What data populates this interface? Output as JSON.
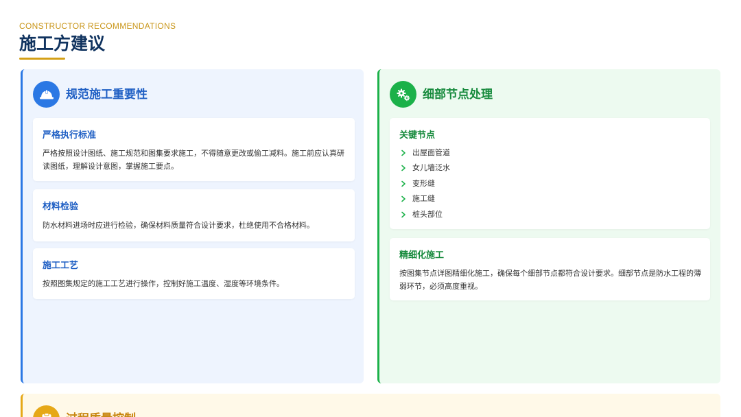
{
  "header": {
    "kicker": "CONSTRUCTOR RECOMMENDATIONS",
    "title": "施工方建议"
  },
  "colors": {
    "blue": "#2b78e4",
    "green": "#1bb149",
    "yellow": "#e6a817",
    "title": "#10335f",
    "gold": "#d4a017"
  },
  "sections": {
    "standards": {
      "icon": "hard-hat-icon",
      "title": "规范施工重要性",
      "items": [
        {
          "heading": "严格执行标准",
          "text": "严格按照设计图纸、施工规范和图集要求施工，不得随意更改或偷工减料。施工前应认真研读图纸，理解设计意图，掌握施工要点。"
        },
        {
          "heading": "材料检验",
          "text": "防水材料进场时应进行检验，确保材料质量符合设计要求，杜绝使用不合格材料。"
        },
        {
          "heading": "施工工艺",
          "text": "按照图集规定的施工工艺进行操作，控制好施工温度、湿度等环境条件。"
        }
      ]
    },
    "details": {
      "icon": "gears-icon",
      "title": "细部节点处理",
      "key_nodes": {
        "heading": "关键节点",
        "items": [
          "出屋面管道",
          "女儿墙泛水",
          "变形缝",
          "施工缝",
          "桩头部位"
        ]
      },
      "refined": {
        "heading": "精细化施工",
        "text": "按图集节点详图精细化施工，确保每个细部节点都符合设计要求。细部节点是防水工程的薄弱环节，必须高度重视。"
      }
    },
    "quality": {
      "icon": "clipboard-icon",
      "title": "过程质量控制"
    }
  }
}
